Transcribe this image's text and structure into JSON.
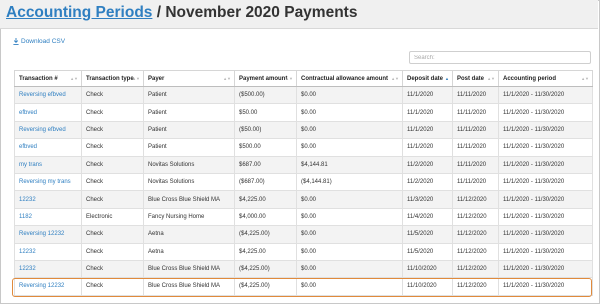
{
  "header": {
    "breadcrumb": "Accounting Periods",
    "separator": " / ",
    "title": "November 2020 Payments"
  },
  "toolbar": {
    "download_label": "Download CSV",
    "search_placeholder": "Search:"
  },
  "table": {
    "columns": [
      "Transaction #",
      "Transaction type",
      "Payer",
      "Payment amount",
      "Contractual allowance amount",
      "Deposit date",
      "Post date",
      "Accounting period"
    ],
    "sorted_column": 5,
    "rows": [
      [
        "Reversing efbved",
        "Check",
        "Patient",
        "($500.00)",
        "$0.00",
        "11/1/2020",
        "11/11/2020",
        "11/1/2020 - 11/30/2020"
      ],
      [
        "efbved",
        "Check",
        "Patient",
        "$50.00",
        "$0.00",
        "11/1/2020",
        "11/11/2020",
        "11/1/2020 - 11/30/2020"
      ],
      [
        "Reversing efbved",
        "Check",
        "Patient",
        "($50.00)",
        "$0.00",
        "11/1/2020",
        "11/11/2020",
        "11/1/2020 - 11/30/2020"
      ],
      [
        "efbved",
        "Check",
        "Patient",
        "$500.00",
        "$0.00",
        "11/1/2020",
        "11/11/2020",
        "11/1/2020 - 11/30/2020"
      ],
      [
        "my trans",
        "Check",
        "Novitas Solutions",
        "$687.00",
        "$4,144.81",
        "11/2/2020",
        "11/11/2020",
        "11/1/2020 - 11/30/2020"
      ],
      [
        "Reversing my trans",
        "Check",
        "Novitas Solutions",
        "($687.00)",
        "($4,144.81)",
        "11/2/2020",
        "11/11/2020",
        "11/1/2020 - 11/30/2020"
      ],
      [
        "12232",
        "Check",
        "Blue Cross Blue Shield MA",
        "$4,225.00",
        "$0.00",
        "11/3/2020",
        "11/12/2020",
        "11/1/2020 - 11/30/2020"
      ],
      [
        "1182",
        "Electronic",
        "Fancy Nursing Home",
        "$4,000.00",
        "$0.00",
        "11/4/2020",
        "11/12/2020",
        "11/1/2020 - 11/30/2020"
      ],
      [
        "Reversing 12232",
        "Check",
        "Aetna",
        "($4,225.00)",
        "$0.00",
        "11/5/2020",
        "11/12/2020",
        "11/1/2020 - 11/30/2020"
      ],
      [
        "12232",
        "Check",
        "Aetna",
        "$4,225.00",
        "$0.00",
        "11/5/2020",
        "11/12/2020",
        "11/1/2020 - 11/30/2020"
      ],
      [
        "12232",
        "Check",
        "Blue Cross Blue Shield MA",
        "($4,225.00)",
        "$0.00",
        "11/10/2020",
        "11/12/2020",
        "11/1/2020 - 11/30/2020"
      ],
      [
        "Reversing 12232",
        "Check",
        "Blue Cross Blue Shield MA",
        "($4,225.00)",
        "$0.00",
        "11/10/2020",
        "11/12/2020",
        "11/1/2020 - 11/30/2020"
      ]
    ]
  },
  "colors": {
    "link": "#2f7fc1",
    "highlight": "#e08a3c"
  }
}
